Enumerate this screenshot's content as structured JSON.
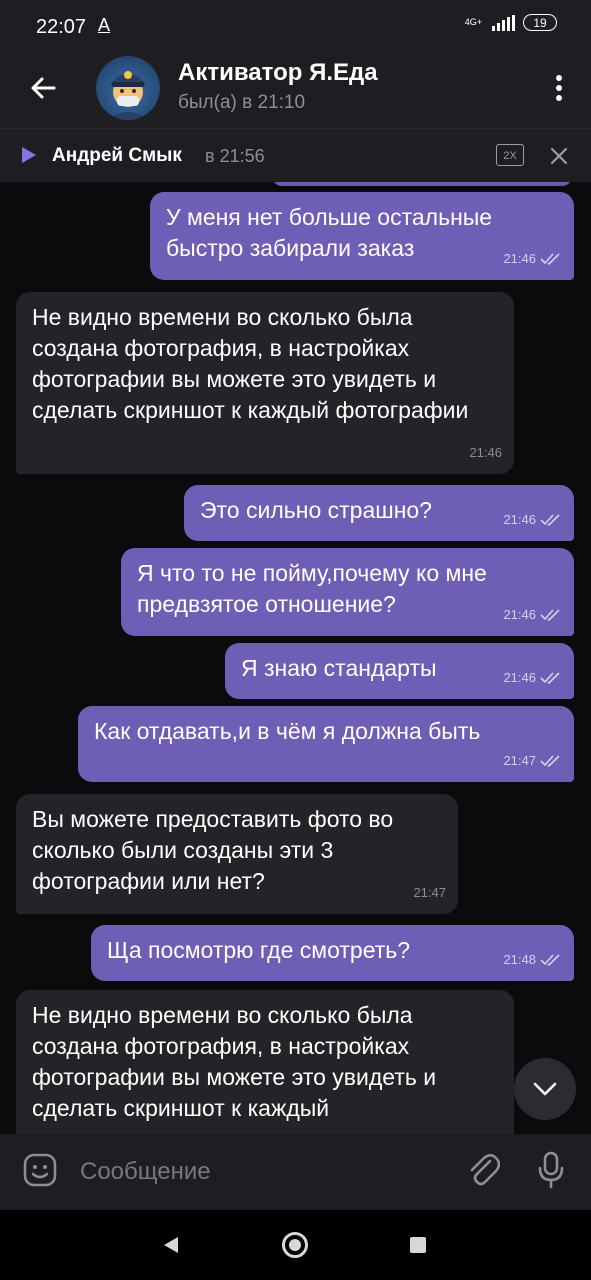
{
  "status_bar": {
    "time": "22:07",
    "notification": "A",
    "network": "4G+",
    "battery": "19"
  },
  "header": {
    "title": "Активатор Я.Еда",
    "subtitle": "был(а) в 21:10"
  },
  "audio_player": {
    "name": "Андрей Смык",
    "time": "в 21:56",
    "speed": "2X"
  },
  "messages": [
    {
      "direction": "out",
      "text": "У меня нет больше остальные быстро забирали заказ",
      "time": "21:46",
      "status": "read"
    },
    {
      "direction": "in",
      "text": "Не видно времени во сколько была создана фотография, в настройках фотографии вы можете это увидеть и сделать скриншот к каждый фотографии",
      "time": "21:46"
    },
    {
      "direction": "out",
      "text": "Это сильно страшно?",
      "time": "21:46",
      "status": "read"
    },
    {
      "direction": "out",
      "text": "Я что то не пойму,почему ко мне предвзятое отношение?",
      "time": "21:46",
      "status": "read"
    },
    {
      "direction": "out",
      "text": "Я знаю стандарты",
      "time": "21:46",
      "status": "read"
    },
    {
      "direction": "out",
      "text": "Как отдавать,и в чём я должна быть",
      "time": "21:47",
      "status": "read"
    },
    {
      "direction": "in",
      "text": "Вы можете предоставить фото во сколько были созданы эти 3 фотографии или нет?",
      "time": "21:47"
    },
    {
      "direction": "out",
      "text": "Ща посмотрю где смотреть?",
      "time": "21:48",
      "status": "read"
    },
    {
      "direction": "in",
      "text": "Не видно времени во сколько была создана фотография, в настройках фотографии вы можете это увидеть и сделать скриншот к каждый",
      "time": ""
    }
  ],
  "composer": {
    "placeholder": "Сообщение"
  },
  "icons": {
    "back": "arrow-left-icon",
    "menu": "more-vertical-icon",
    "play": "play-icon",
    "close": "close-icon",
    "emoji": "emoji-icon",
    "attach": "paperclip-icon",
    "mic": "microphone-icon",
    "scroll_down": "chevron-down-icon",
    "read": "double-check-icon"
  },
  "colors": {
    "background": "#0b0b0d",
    "bar": "#1e1e22",
    "outgoing": "#6f5eb5",
    "incoming": "#242428",
    "accent": "#8774e1"
  }
}
